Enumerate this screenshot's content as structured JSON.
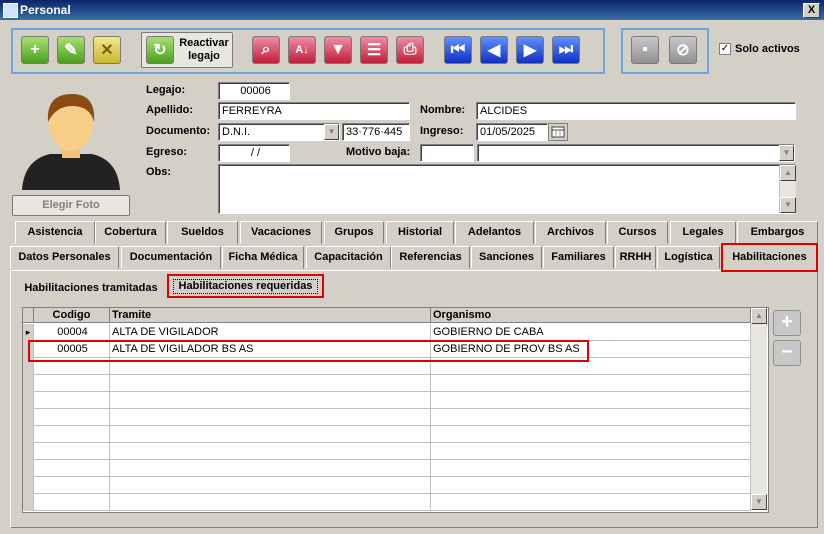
{
  "window": {
    "title": "Personal",
    "close_label": "X"
  },
  "toolbar": {
    "reactivar_label": "Reactivar legajo",
    "solo_activos_label": "Solo activos",
    "solo_activos_checked": true
  },
  "photo": {
    "elegir_label": "Elegir Foto"
  },
  "form": {
    "legajo_label": "Legajo:",
    "legajo": "00006",
    "apellido_label": "Apellido:",
    "apellido": "FERREYRA",
    "nombre_label": "Nombre:",
    "nombre": "ALCIDES",
    "documento_label": "Documento:",
    "tipo_doc": "D.N.I.",
    "nro_doc": "33·776·445",
    "ingreso_label": "Ingreso:",
    "ingreso": "01/05/2025",
    "egreso_label": "Egreso:",
    "egreso": "/ /",
    "motivo_label": "Motivo baja:",
    "motivo_code": "",
    "motivo_desc": "",
    "obs_label": "Obs:",
    "obs": ""
  },
  "tabs_row1": [
    "Asistencia",
    "Cobertura",
    "Sueldos",
    "Vacaciones",
    "Grupos",
    "Historial",
    "Adelantos",
    "Archivos",
    "Cursos",
    "Legales",
    "Embargos"
  ],
  "tabs_row2": [
    "Datos Personales",
    "Documentación",
    "Ficha Médica",
    "Capacitación",
    "Referencias",
    "Sanciones",
    "Familiares",
    "RRHH",
    "Logística",
    "Habilitaciones"
  ],
  "active_tab": "Habilitaciones",
  "subtabs": [
    "Habilitaciones tramitadas",
    "Habilitaciones requeridas"
  ],
  "active_subtab": "Habilitaciones requeridas",
  "grid": {
    "columns": [
      "Codigo",
      "Tramite",
      "Organismo"
    ],
    "rows": [
      [
        "00004",
        "ALTA DE VIGILADOR",
        "GOBIERNO DE CABA"
      ],
      [
        "00005",
        "ALTA DE VIGILADOR BS AS",
        "GOBIERNO DE PROV BS AS"
      ]
    ],
    "current_row_marker": "▸"
  }
}
